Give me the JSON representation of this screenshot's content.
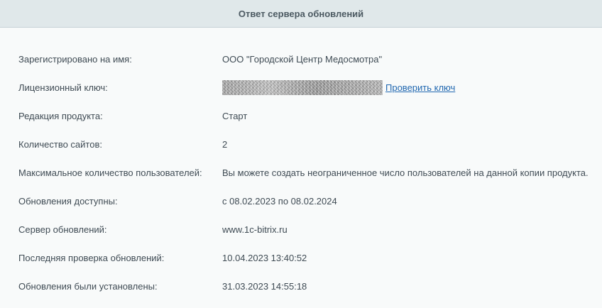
{
  "header": {
    "title": "Ответ сервера обновлений"
  },
  "rows": [
    {
      "label": "Зарегистрировано на имя:",
      "value": "ООО \"Городской Центр Медосмотра\""
    },
    {
      "label": "Лицензионный ключ:",
      "value": "",
      "link": "Проверить ключ"
    },
    {
      "label": "Редакция продукта:",
      "value": "Старт"
    },
    {
      "label": "Количество сайтов:",
      "value": "2"
    },
    {
      "label": "Максимальное количество пользователей:",
      "value": "Вы можете создать неограниченное число пользователей на данной копии продукта."
    },
    {
      "label": "Обновления доступны:",
      "value": "с 08.02.2023 по 08.02.2024"
    },
    {
      "label": "Сервер обновлений:",
      "value": "www.1c-bitrix.ru"
    },
    {
      "label": "Последняя проверка обновлений:",
      "value": "10.04.2023 13:40:52"
    },
    {
      "label": "Обновления были установлены:",
      "value": "31.03.2023 14:55:18"
    }
  ]
}
